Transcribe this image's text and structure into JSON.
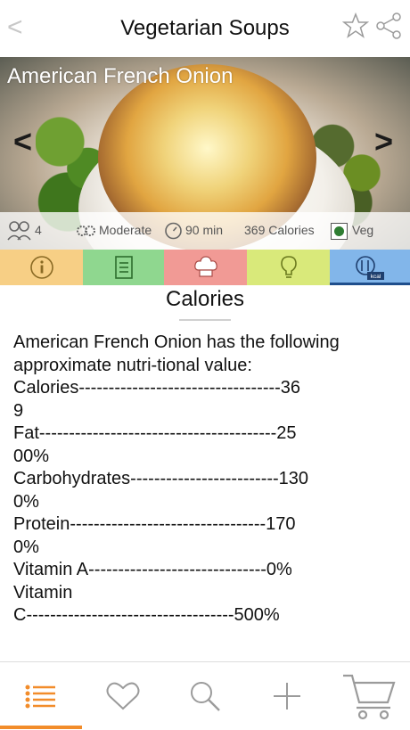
{
  "header": {
    "back_glyph": "<",
    "title": "Vegetarian Soups"
  },
  "hero": {
    "title": "American French Onion",
    "prev_glyph": "<",
    "next_glyph": ">"
  },
  "info": {
    "servings": "4",
    "difficulty": "Moderate",
    "time": "90 min",
    "calories": "369 Calories",
    "diet": "Veg"
  },
  "tabs": [
    {
      "name": "info",
      "color": "#f7cf85"
    },
    {
      "name": "ingredients",
      "color": "#8fd78f"
    },
    {
      "name": "chef",
      "color": "#f19a95"
    },
    {
      "name": "tips",
      "color": "#d9e97a"
    },
    {
      "name": "calories",
      "color": "#82b6ea",
      "badge": "kcal"
    }
  ],
  "section_title": "Calories",
  "content_lines": [
    "American French Onion has the following",
    "approximate nutri-tional value:",
    "",
    "Calories----------------------------------36",
    "9",
    "Fat----------------------------------------25",
    "00%",
    "Carbohydrates-------------------------130",
    "0%",
    "Protein---------------------------------170",
    "0%",
    "",
    "Vitamin A------------------------------0%",
    "Vitamin",
    "C-----------------------------------500%"
  ],
  "colors": {
    "accent": "#f28c2a",
    "tab_underline": "#1f4e8c"
  }
}
